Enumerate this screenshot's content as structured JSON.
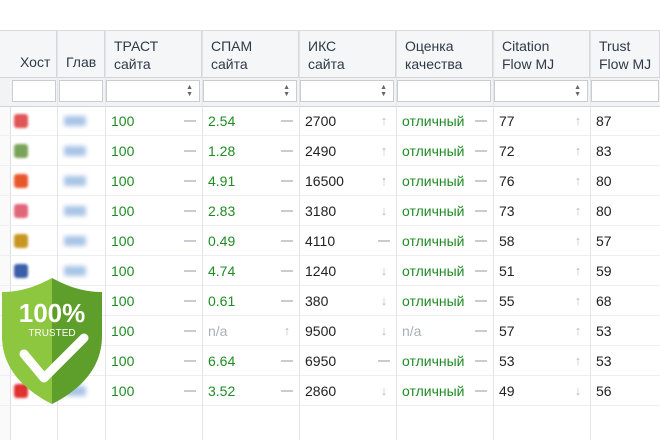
{
  "header": {
    "dots": "..",
    "host": "Хост",
    "main": "Глав",
    "trust": [
      "ТРАСТ",
      "сайта"
    ],
    "spam": [
      "СПАМ",
      "сайта"
    ],
    "iks": [
      "ИКС",
      "сайта"
    ],
    "quality": [
      "Оценка",
      "качества"
    ],
    "citation": [
      "Citation",
      "Flow MJ"
    ],
    "trustflow": [
      "Trust",
      "Flow MJ"
    ]
  },
  "rows": [
    {
      "trust": "100",
      "spam": "2.54",
      "iks": "2700",
      "quality": "отличный",
      "cf": "77",
      "tf": "87",
      "fav": "#e05555",
      "spamTrend": "dash",
      "iksTrend": "up",
      "cfTrend": "up"
    },
    {
      "trust": "100",
      "spam": "1.28",
      "iks": "2490",
      "quality": "отличный",
      "cf": "72",
      "tf": "83",
      "fav": "#7aa35a",
      "spamTrend": "dash",
      "iksTrend": "up",
      "cfTrend": "up"
    },
    {
      "trust": "100",
      "spam": "4.91",
      "iks": "16500",
      "quality": "отличный",
      "cf": "76",
      "tf": "80",
      "fav": "#e8572b",
      "spamTrend": "dash",
      "iksTrend": "up",
      "cfTrend": "up"
    },
    {
      "trust": "100",
      "spam": "2.83",
      "iks": "3180",
      "quality": "отличный",
      "cf": "73",
      "tf": "80",
      "fav": "#e0667a",
      "spamTrend": "dash",
      "iksTrend": "down",
      "cfTrend": "up"
    },
    {
      "trust": "100",
      "spam": "0.49",
      "iks": "4110",
      "quality": "отличный",
      "cf": "58",
      "tf": "57",
      "fav": "#c8951f",
      "spamTrend": "dash",
      "iksTrend": "dash",
      "cfTrend": "up"
    },
    {
      "trust": "100",
      "spam": "4.74",
      "iks": "1240",
      "quality": "отличный",
      "cf": "51",
      "tf": "59",
      "fav": "#3b5ea8",
      "spamTrend": "dash",
      "iksTrend": "down",
      "cfTrend": "up"
    },
    {
      "trust": "100",
      "spam": "0.61",
      "iks": "380",
      "quality": "отличный",
      "cf": "55",
      "tf": "68",
      "fav": "#5a88c8",
      "spamTrend": "dash",
      "iksTrend": "down",
      "cfTrend": "up"
    },
    {
      "trust": "100",
      "spam": "n/a",
      "iks": "9500",
      "quality": "n/a",
      "cf": "57",
      "tf": "53",
      "fav": "#999999",
      "spamTrend": "up",
      "iksTrend": "down",
      "cfTrend": "up"
    },
    {
      "trust": "100",
      "spam": "6.64",
      "iks": "6950",
      "quality": "отличный",
      "cf": "53",
      "tf": "53",
      "fav": "#6aa8d0",
      "spamTrend": "dash",
      "iksTrend": "dash",
      "cfTrend": "up"
    },
    {
      "trust": "100",
      "spam": "3.52",
      "iks": "2860",
      "quality": "отличный",
      "cf": "49",
      "tf": "56",
      "fav": "#e03030",
      "spamTrend": "dash",
      "iksTrend": "down",
      "cfTrend": "down"
    }
  ],
  "badge": {
    "percent": "100%",
    "label": "TRUSTED"
  },
  "colors": {
    "green": "#1f8b24",
    "badge_light": "#8dc63f",
    "badge_dark": "#5e9e2a"
  }
}
